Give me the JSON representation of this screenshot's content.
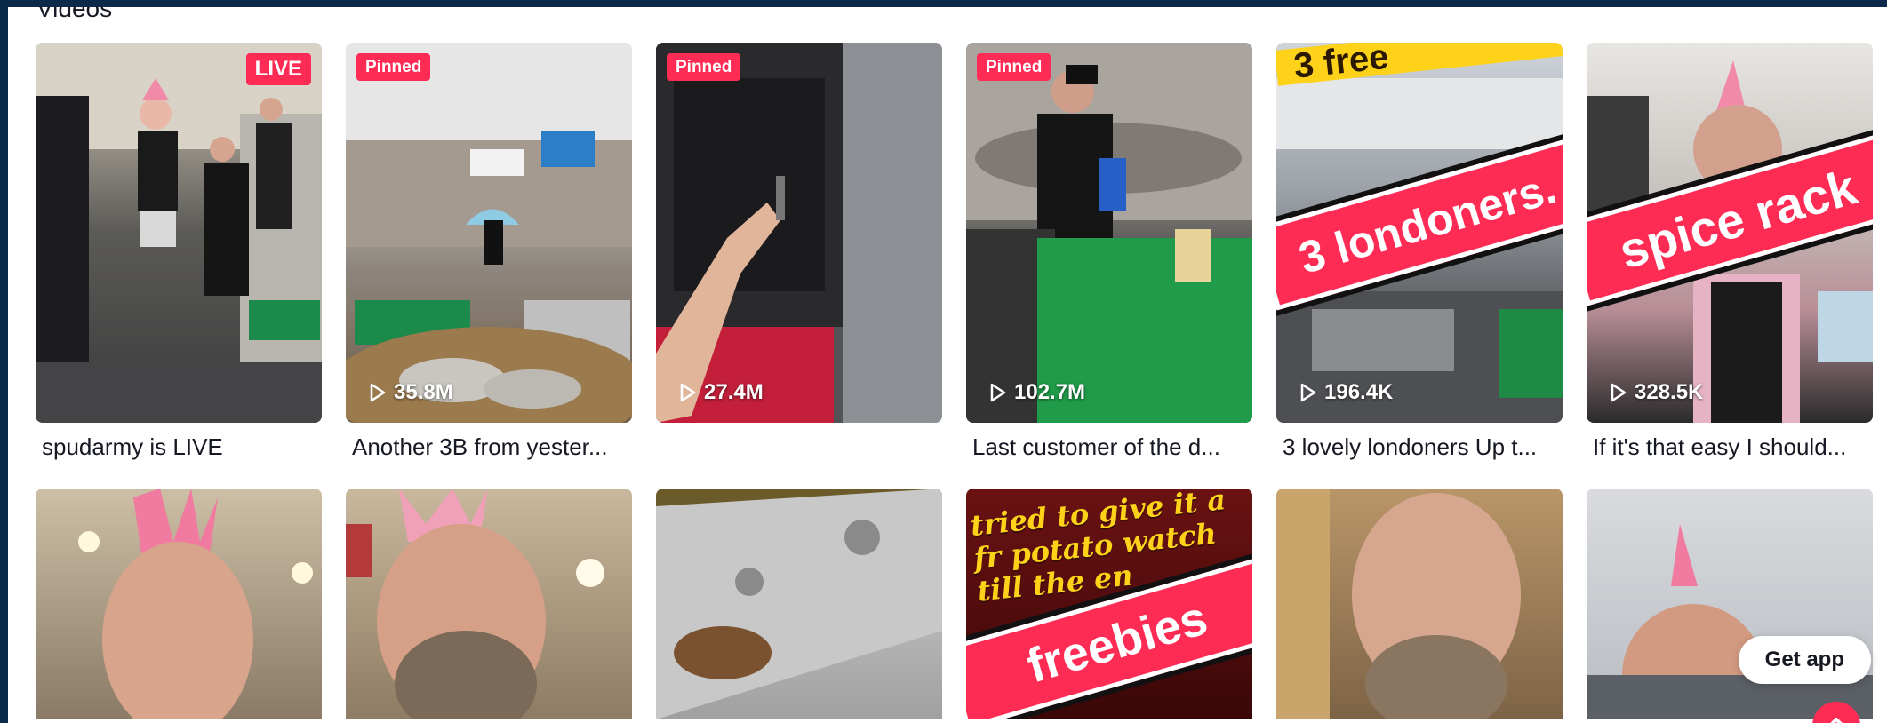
{
  "section": {
    "title": "Videos"
  },
  "row1": [
    {
      "caption": "spudarmy is LIVE",
      "badge": "LIVE",
      "views": ""
    },
    {
      "caption": "Another 3B from yester...",
      "badge": "Pinned",
      "views": "35.8M"
    },
    {
      "caption": "",
      "badge": "Pinned",
      "views": "27.4M"
    },
    {
      "caption": "Last customer of the d...",
      "badge": "Pinned",
      "views": "102.7M"
    },
    {
      "caption": "3 lovely londoners Up t...",
      "badge": "",
      "views": "196.4K",
      "overlay": "3 londoners.",
      "top_text": "3 free"
    },
    {
      "caption": "If it's that easy I should...",
      "badge": "",
      "views": "328.5K",
      "overlay": "spice rack"
    }
  ],
  "row2": [
    {
      "overlay": ""
    },
    {
      "overlay": ""
    },
    {
      "overlay": ""
    },
    {
      "overlay": "freebies",
      "headline": "tried to give it a fr potato watch till the en"
    },
    {
      "overlay": ""
    },
    {
      "overlay": ""
    }
  ],
  "floating": {
    "get_app_label": "Get app"
  },
  "colors": {
    "accent": "#fe2c55",
    "text": "#161823",
    "frame": "#0b2a4a"
  }
}
